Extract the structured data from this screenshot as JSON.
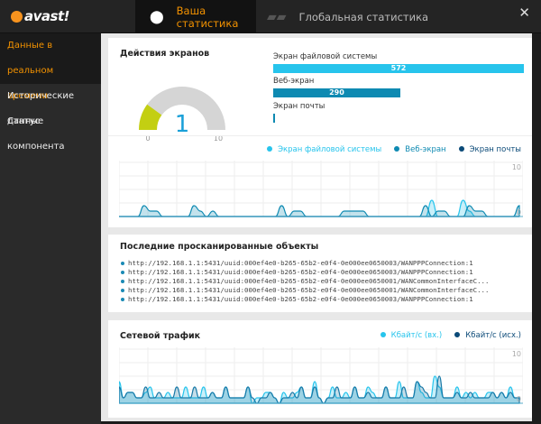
{
  "app": {
    "logo": "avast!",
    "close": "✕"
  },
  "tabs": [
    {
      "label": "Ваша статистика",
      "icon": "location-pin-icon",
      "active": true
    },
    {
      "label": "Глобальная статистика",
      "icon": "world-map-icon",
      "active": false
    }
  ],
  "sidebar": {
    "items": [
      {
        "label": "Данные в реальном времени",
        "active": true
      },
      {
        "label": "Исторические данные"
      },
      {
        "label": "Статус компонента"
      }
    ]
  },
  "screens": {
    "title": "Действия экранов",
    "gauge": {
      "value": "1",
      "min": "0",
      "max": "10",
      "fraction": 0.1,
      "colors": {
        "fill": "#c3cf12",
        "track": "#d5d5d5",
        "text": "#1aa0d8"
      }
    },
    "bars": [
      {
        "label": "Экран файловой системы",
        "value": 572,
        "text": "572",
        "color": "#27c4ec"
      },
      {
        "label": "Веб-экран",
        "value": 290,
        "text": "290",
        "color": "#0e8ab2"
      },
      {
        "label": "Экран почты",
        "value": 0,
        "text": "",
        "color": "#0e8ab2"
      }
    ],
    "legend": [
      {
        "label": "Экран файловой системы",
        "color": "#27c4ec"
      },
      {
        "label": "Веб-экран",
        "color": "#0e8ab2"
      },
      {
        "label": "Экран почты",
        "color": "#0b4a78"
      }
    ]
  },
  "chart_data": [
    {
      "type": "area",
      "ylim": [
        0,
        10
      ],
      "tick_labels": [
        "10",
        "0"
      ],
      "grid": true,
      "series": [
        {
          "name": "Экран файловой системы",
          "values": [
            0,
            0,
            0,
            0,
            0,
            0,
            0,
            0,
            0,
            0,
            0,
            0,
            0,
            0,
            0,
            0,
            0,
            0,
            0,
            0,
            0,
            0,
            0,
            0,
            0,
            0,
            0,
            0,
            0,
            0,
            0,
            0,
            0,
            0,
            0,
            0,
            0,
            0,
            0,
            0,
            0,
            0,
            0,
            0,
            0,
            0,
            0,
            0,
            0,
            0,
            3,
            0,
            0,
            0,
            0,
            3,
            1,
            0,
            0,
            0,
            0,
            0,
            0,
            0,
            0
          ]
        },
        {
          "name": "Веб-экран",
          "values": [
            0,
            0,
            0,
            0,
            2,
            1,
            1,
            0,
            0,
            0,
            0,
            0,
            2,
            1,
            0,
            1,
            0,
            0,
            0,
            0,
            0,
            0,
            0,
            0,
            0,
            0,
            2,
            0,
            1,
            1,
            0,
            0,
            0,
            0,
            0,
            0,
            1,
            1,
            1,
            1,
            0,
            0,
            0,
            0,
            0,
            0,
            0,
            0,
            0,
            2,
            0,
            1,
            1,
            0,
            0,
            0,
            2,
            1,
            1,
            0,
            0,
            0,
            0,
            0,
            2
          ]
        },
        {
          "name": "Экран почты",
          "values": [
            0,
            0,
            0,
            0,
            0,
            0,
            0,
            0,
            0,
            0,
            0,
            0,
            0,
            0,
            0,
            0,
            0,
            0,
            0,
            0,
            0,
            0,
            0,
            0,
            0,
            0,
            0,
            0,
            0,
            0,
            0,
            0,
            0,
            0,
            0,
            0,
            0,
            0,
            0,
            0,
            0,
            0,
            0,
            0,
            0,
            0,
            0,
            0,
            0,
            0,
            0,
            0,
            0,
            0,
            0,
            0,
            0,
            0,
            0,
            0,
            0,
            0,
            0,
            0,
            0
          ]
        }
      ]
    },
    {
      "type": "area",
      "ylim": [
        0,
        10
      ],
      "tick_labels": [
        "10",
        "0"
      ],
      "grid": true,
      "series": [
        {
          "name": "Кбайт/с (вх.)",
          "values": [
            4,
            1,
            2,
            2,
            1,
            1,
            2,
            3,
            1,
            1,
            1,
            2,
            1,
            1,
            1,
            3,
            1,
            1,
            1,
            3,
            1,
            2,
            1,
            1,
            3,
            1,
            1,
            1,
            1,
            3,
            0,
            1,
            1,
            2,
            2,
            1,
            0,
            2,
            1,
            1,
            2,
            3,
            1,
            1,
            4,
            1,
            0,
            1,
            3,
            1,
            1,
            2,
            1,
            3,
            1,
            1,
            3,
            2,
            1,
            1,
            3,
            1,
            1,
            4,
            1,
            1,
            1,
            4,
            2,
            1,
            1,
            5,
            3,
            1,
            1,
            1,
            3,
            1,
            2,
            1,
            2,
            1,
            1,
            2,
            2,
            1,
            2,
            1,
            3,
            1,
            1
          ]
        },
        {
          "name": "Кбайт/с (исх.)",
          "values": [
            3,
            1,
            2,
            2,
            1,
            1,
            3,
            1,
            1,
            2,
            1,
            1,
            1,
            3,
            1,
            1,
            1,
            3,
            1,
            1,
            1,
            2,
            1,
            1,
            3,
            1,
            1,
            1,
            1,
            3,
            1,
            0,
            1,
            1,
            2,
            1,
            0,
            1,
            1,
            2,
            1,
            3,
            1,
            1,
            3,
            1,
            0,
            1,
            1,
            3,
            1,
            1,
            1,
            3,
            1,
            1,
            2,
            1,
            1,
            1,
            3,
            1,
            1,
            1,
            3,
            1,
            1,
            4,
            3,
            2,
            1,
            1,
            5,
            1,
            1,
            1,
            2,
            1,
            1,
            2,
            1,
            1,
            1,
            1,
            2,
            1,
            2,
            1,
            2,
            1,
            1
          ]
        }
      ]
    }
  ],
  "recent": {
    "title": "Последние просканированные объекты",
    "items": [
      "http://192.168.1.1:5431/uuid:000ef4e0-b265-65b2-e0f4-0e000ee0650003/WANPPPConnection:1",
      "http://192.168.1.1:5431/uuid:000ef4e0-b265-65b2-e0f4-0e000ee0650003/WANPPPConnection:1",
      "http://192.168.1.1:5431/uuid:000ef4e0-b265-65b2-e0f4-0e000ee0650001/WANCommonInterfaceC...",
      "http://192.168.1.1:5431/uuid:000ef4e0-b265-65b2-e0f4-0e000ee0650001/WANCommonInterfaceC...",
      "http://192.168.1.1:5431/uuid:000ef4e0-b265-65b2-e0f4-0e000ee0650003/WANPPPConnection:1"
    ]
  },
  "network": {
    "title": "Сетевой трафик",
    "legend": [
      {
        "label": "Кбайт/с (вх.)",
        "color": "#27c4ec"
      },
      {
        "label": "Кбайт/с (исх.)",
        "color": "#0b4a78"
      }
    ]
  }
}
